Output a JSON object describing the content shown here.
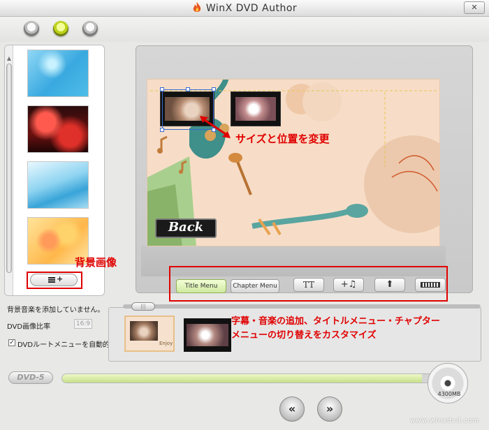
{
  "window": {
    "title": "WinX DVD Author",
    "close_label": "✕"
  },
  "steps": [
    {
      "name": "step-1",
      "active": false
    },
    {
      "name": "step-2",
      "active": true
    },
    {
      "name": "step-3",
      "active": false
    }
  ],
  "background_panel": {
    "add_button_icon": "add-background-icon",
    "annotation": "背景画像"
  },
  "preview": {
    "back_label": "Back",
    "annotation": "サイズと位置を変更"
  },
  "toolbar": {
    "title_menu_label": "Title Menu",
    "chapter_menu_label": "Chapter Menu",
    "text_button_label": "TT",
    "music_button_label": "+♫",
    "up_button_label": "⬆",
    "subtitle_button_label": ""
  },
  "settings": {
    "bgm_status": "背景音楽を添加していません。",
    "ratio_label": "DVD画像比率",
    "ratio_value": "16:9",
    "auto_root_menu_label": "DVDルートメニューを自動的に添加する",
    "auto_root_menu_checked": true
  },
  "menu_strip": {
    "annotation_line1": "字幕・音楽の追加、タイトルメニュー・チャプター",
    "annotation_line2": "メニューの切り替えをカスタマイズ",
    "thumb_caption": "Enjoy"
  },
  "footer": {
    "dvd_type": "DVD-5",
    "capacity_label": "4300MB",
    "capacity_used_fraction": 0.93,
    "prev_label": "«",
    "next_label": "»",
    "site": "www.winxdvd.com"
  },
  "colors": {
    "annotation_red": "#e00000",
    "active_step": "#bcd21b",
    "canvas_bg": "#f7ddc7"
  }
}
